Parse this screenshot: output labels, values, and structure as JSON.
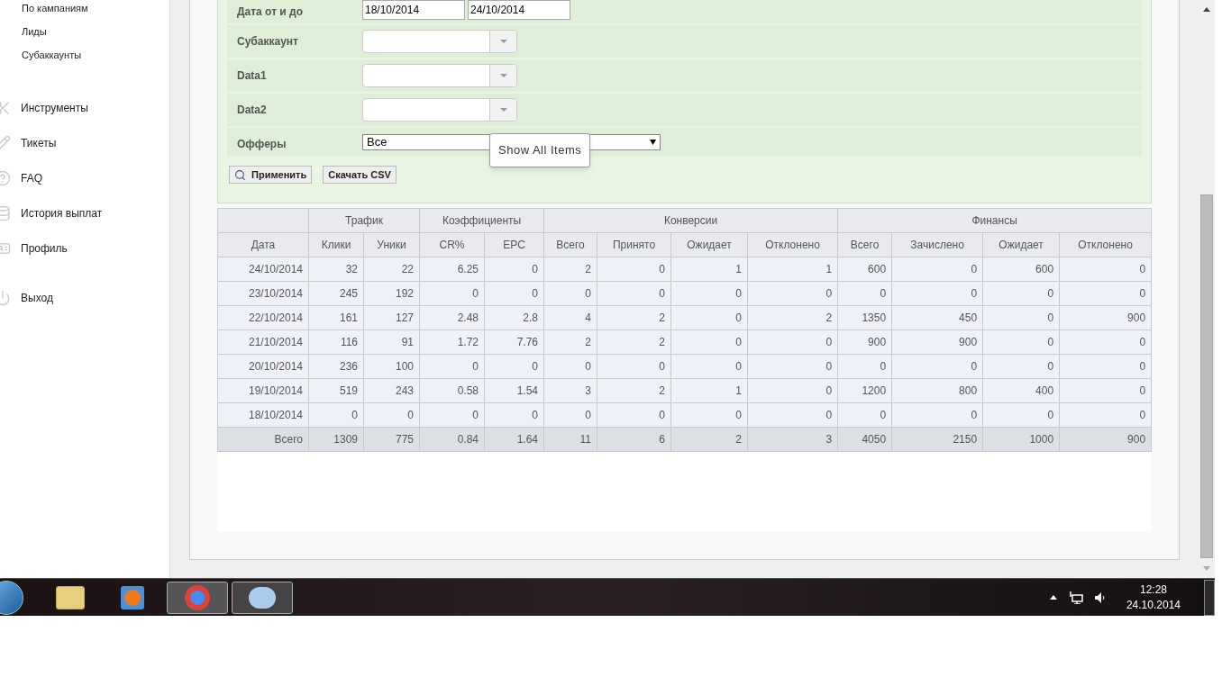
{
  "sidebar": {
    "sub_items": [
      "По кампаниям",
      "Лиды",
      "Субаккаунты"
    ],
    "items": [
      {
        "label": "Инструменты"
      },
      {
        "label": "Тикеты"
      },
      {
        "label": "FAQ"
      },
      {
        "label": "История выплат"
      },
      {
        "label": "Профиль"
      },
      {
        "label": "Выход"
      }
    ]
  },
  "filters": [
    {
      "kind": "date_range",
      "label": "Дата от и до",
      "values": [
        "18/10/2014",
        "24/10/2014"
      ]
    },
    {
      "kind": "combo",
      "label": "Субаккаунт"
    },
    {
      "kind": "combo",
      "label": "Data1"
    },
    {
      "kind": "combo",
      "label": "Data2"
    },
    {
      "kind": "select",
      "label": "Офферы",
      "value": "Все",
      "tooltip": "Show All Items"
    }
  ],
  "buttons": [
    {
      "kind": "search",
      "label": "Применить"
    },
    {
      "kind": "plain",
      "label": "Скачать CSV"
    }
  ],
  "table": {
    "groups": [
      {
        "columns": [
          "Дата"
        ]
      },
      {
        "label": "Трафик",
        "columns": [
          "Клики",
          "Уники"
        ]
      },
      {
        "label": "Коэффициенты",
        "columns": [
          "CR%",
          "EPC"
        ]
      },
      {
        "label": "Конверсии",
        "columns": [
          "Всего",
          "Принято",
          "Ожидает",
          "Отклонено"
        ]
      },
      {
        "label": "Финансы",
        "columns": [
          "Всего",
          "Зачислено",
          "Ожидает",
          "Отклонено"
        ]
      }
    ],
    "rows": [
      [
        "24/10/2014",
        "32",
        "22",
        "6.25",
        "0",
        "2",
        "0",
        "1",
        "1",
        "600",
        "0",
        "600",
        "0"
      ],
      [
        "23/10/2014",
        "245",
        "192",
        "0",
        "0",
        "0",
        "0",
        "0",
        "0",
        "0",
        "0",
        "0",
        "0"
      ],
      [
        "22/10/2014",
        "161",
        "127",
        "2.48",
        "2.8",
        "4",
        "2",
        "0",
        "2",
        "1350",
        "450",
        "0",
        "900"
      ],
      [
        "21/10/2014",
        "116",
        "91",
        "1.72",
        "7.76",
        "2",
        "2",
        "0",
        "0",
        "900",
        "900",
        "0",
        "0"
      ],
      [
        "20/10/2014",
        "236",
        "100",
        "0",
        "0",
        "0",
        "0",
        "0",
        "0",
        "0",
        "0",
        "0",
        "0"
      ],
      [
        "19/10/2014",
        "519",
        "243",
        "0.58",
        "1.54",
        "3",
        "2",
        "1",
        "0",
        "1200",
        "800",
        "400",
        "0"
      ],
      [
        "18/10/2014",
        "0",
        "0",
        "0",
        "0",
        "0",
        "0",
        "0",
        "0",
        "0",
        "0",
        "0",
        "0"
      ]
    ],
    "total": [
      "Всего",
      "1309",
      "775",
      "0.84",
      "1.64",
      "11",
      "6",
      "2",
      "3",
      "4050",
      "2150",
      "1000",
      "900"
    ]
  },
  "taskbar": {
    "time": "12:28",
    "date": "24.10.2014"
  }
}
